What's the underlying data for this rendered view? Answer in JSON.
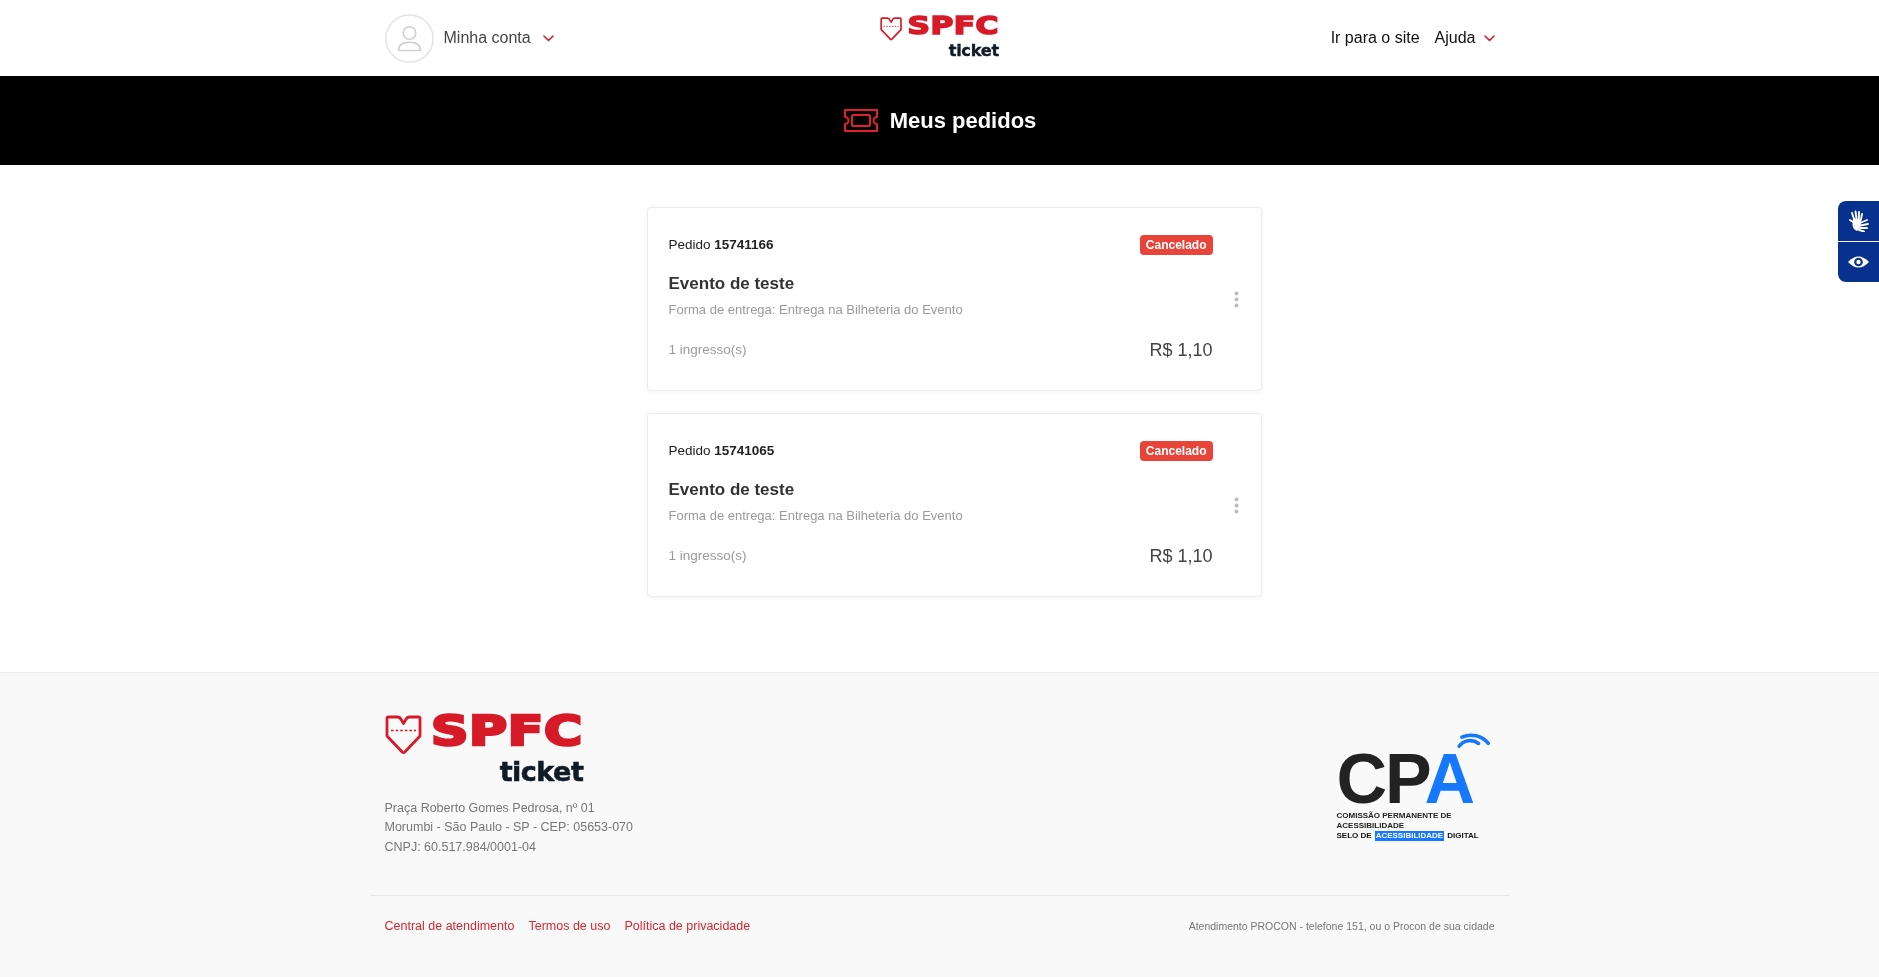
{
  "header": {
    "account_menu": {
      "label": "Minha conta"
    },
    "logo": {
      "wordmark": "SPFC",
      "subtitle": "ticket"
    },
    "nav": [
      {
        "kind": "link",
        "label": "Ir para o site"
      },
      {
        "kind": "dropdown",
        "label": "Ajuda"
      }
    ]
  },
  "banner": {
    "title": "Meus pedidos"
  },
  "orders": [
    {
      "order_number": "Pedido **15741166**",
      "status": "Cancelado",
      "event": "Evento de teste",
      "delivery": "Forma de entrega: Entrega na Bilheteria do Evento",
      "tickets": "1 ingresso(s)",
      "total": "R$ 1,10"
    },
    {
      "order_number": "Pedido **15741065**",
      "status": "Cancelado",
      "event": "Evento de teste",
      "delivery": "Forma de entrega: Entrega na Bilheteria do Evento",
      "tickets": "1 ingresso(s)",
      "total": "R$ 1,10"
    }
  ],
  "footer": {
    "logo": {
      "wordmark": "SPFC",
      "subtitle": "ticket"
    },
    "address_lines": [
      "Praça Roberto Gomes Pedrosa, nº 01",
      "Morumbi - São Paulo - SP - CEP: 05653-070",
      "CNPJ: 60.517.984/0001-04"
    ],
    "seal": {
      "letters": "CP",
      "accent_letter": "A",
      "caption": "COMISSÃO PERMANENTE DE ACESSIBILIDADE",
      "label_start": "SELO DE",
      "label_highlight": "ACESSIBILIDADE",
      "label_end": "DIGITAL"
    },
    "links": [
      "Central de atendimento",
      "Termos de uso",
      "Política de privacidade"
    ],
    "notice": "Atendimento PROCON - telefone 151, ou o Procon de sua cidade"
  }
}
